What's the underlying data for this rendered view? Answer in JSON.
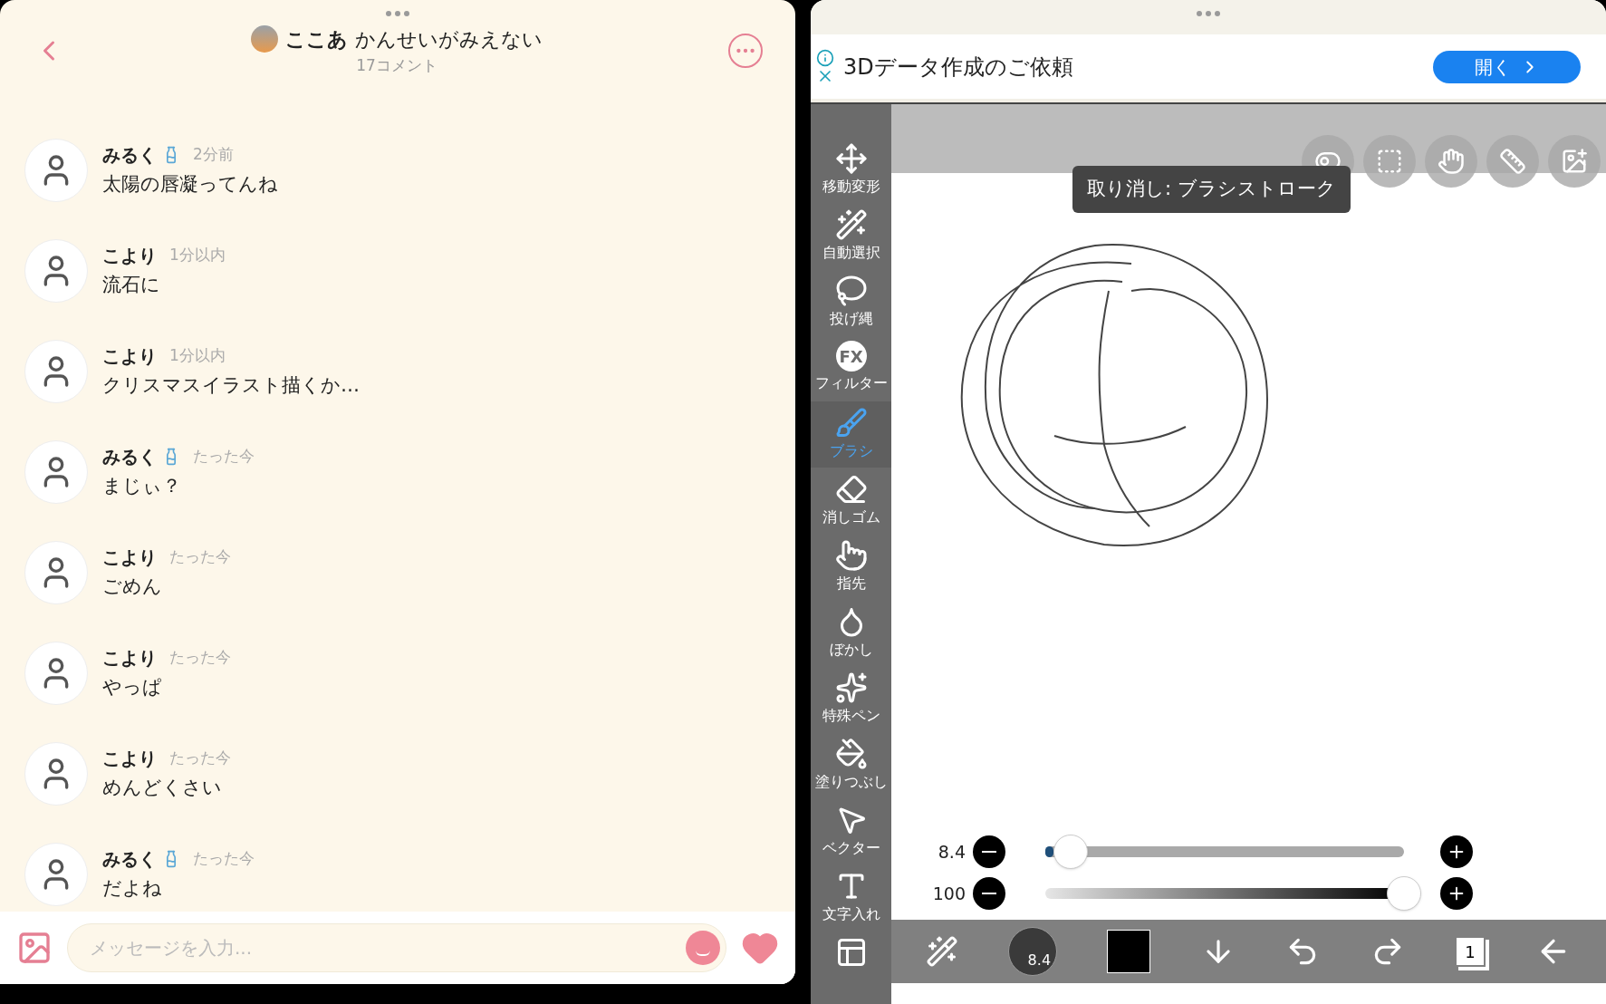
{
  "chat": {
    "title_user": "ここあ",
    "title_text": "かんせいがみえない",
    "subtitle": "17コメント",
    "comments": [
      {
        "name": "みるく",
        "bottle": true,
        "time": "2分前",
        "text": "太陽の唇凝ってんね"
      },
      {
        "name": "こより",
        "bottle": false,
        "time": "1分以内",
        "text": "流石に"
      },
      {
        "name": "こより",
        "bottle": false,
        "time": "1分以内",
        "text": "クリスマスイラスト描くか…"
      },
      {
        "name": "みるく",
        "bottle": true,
        "time": "たった今",
        "text": "まじぃ？"
      },
      {
        "name": "こより",
        "bottle": false,
        "time": "たった今",
        "text": "ごめん"
      },
      {
        "name": "こより",
        "bottle": false,
        "time": "たった今",
        "text": "やっぱ"
      },
      {
        "name": "こより",
        "bottle": false,
        "time": "たった今",
        "text": "めんどくさい"
      },
      {
        "name": "みるく",
        "bottle": true,
        "time": "たった今",
        "text": "だよね"
      }
    ],
    "input": {
      "placeholder": "メッセージを入力..."
    }
  },
  "ad": {
    "text": "3Dデータ作成のご依頼",
    "button": "開く"
  },
  "tooltip": "取り消し: ブラシストローク",
  "tools": [
    {
      "kind": "move",
      "label": "移動変形",
      "selected": false
    },
    {
      "kind": "wand",
      "label": "自動選択",
      "selected": false
    },
    {
      "kind": "lasso",
      "label": "投げ縄",
      "selected": false
    },
    {
      "kind": "filter",
      "icon_text": "FX",
      "label": "フィルター",
      "selected": false
    },
    {
      "kind": "brush",
      "label": "ブラシ",
      "selected": true
    },
    {
      "kind": "eraser",
      "label": "消しゴム",
      "selected": false
    },
    {
      "kind": "finger",
      "label": "指先",
      "selected": false
    },
    {
      "kind": "blur",
      "label": "ぼかし",
      "selected": false
    },
    {
      "kind": "special",
      "label": "特殊ペン",
      "selected": false
    },
    {
      "kind": "fill",
      "label": "塗りつぶし",
      "selected": false
    },
    {
      "kind": "vector",
      "label": "ベクター",
      "selected": false
    },
    {
      "kind": "text",
      "label": "文字入れ",
      "selected": false
    },
    {
      "kind": "frame",
      "selected": false
    }
  ],
  "sliders": [
    {
      "kind": "size",
      "reading": "8.4",
      "level": 0.07
    },
    {
      "kind": "opacity",
      "reading": "100",
      "level": 1.0
    }
  ],
  "bottom_bar": {
    "brush_size": "8.4",
    "color": "#000000",
    "layer_count": "1"
  }
}
